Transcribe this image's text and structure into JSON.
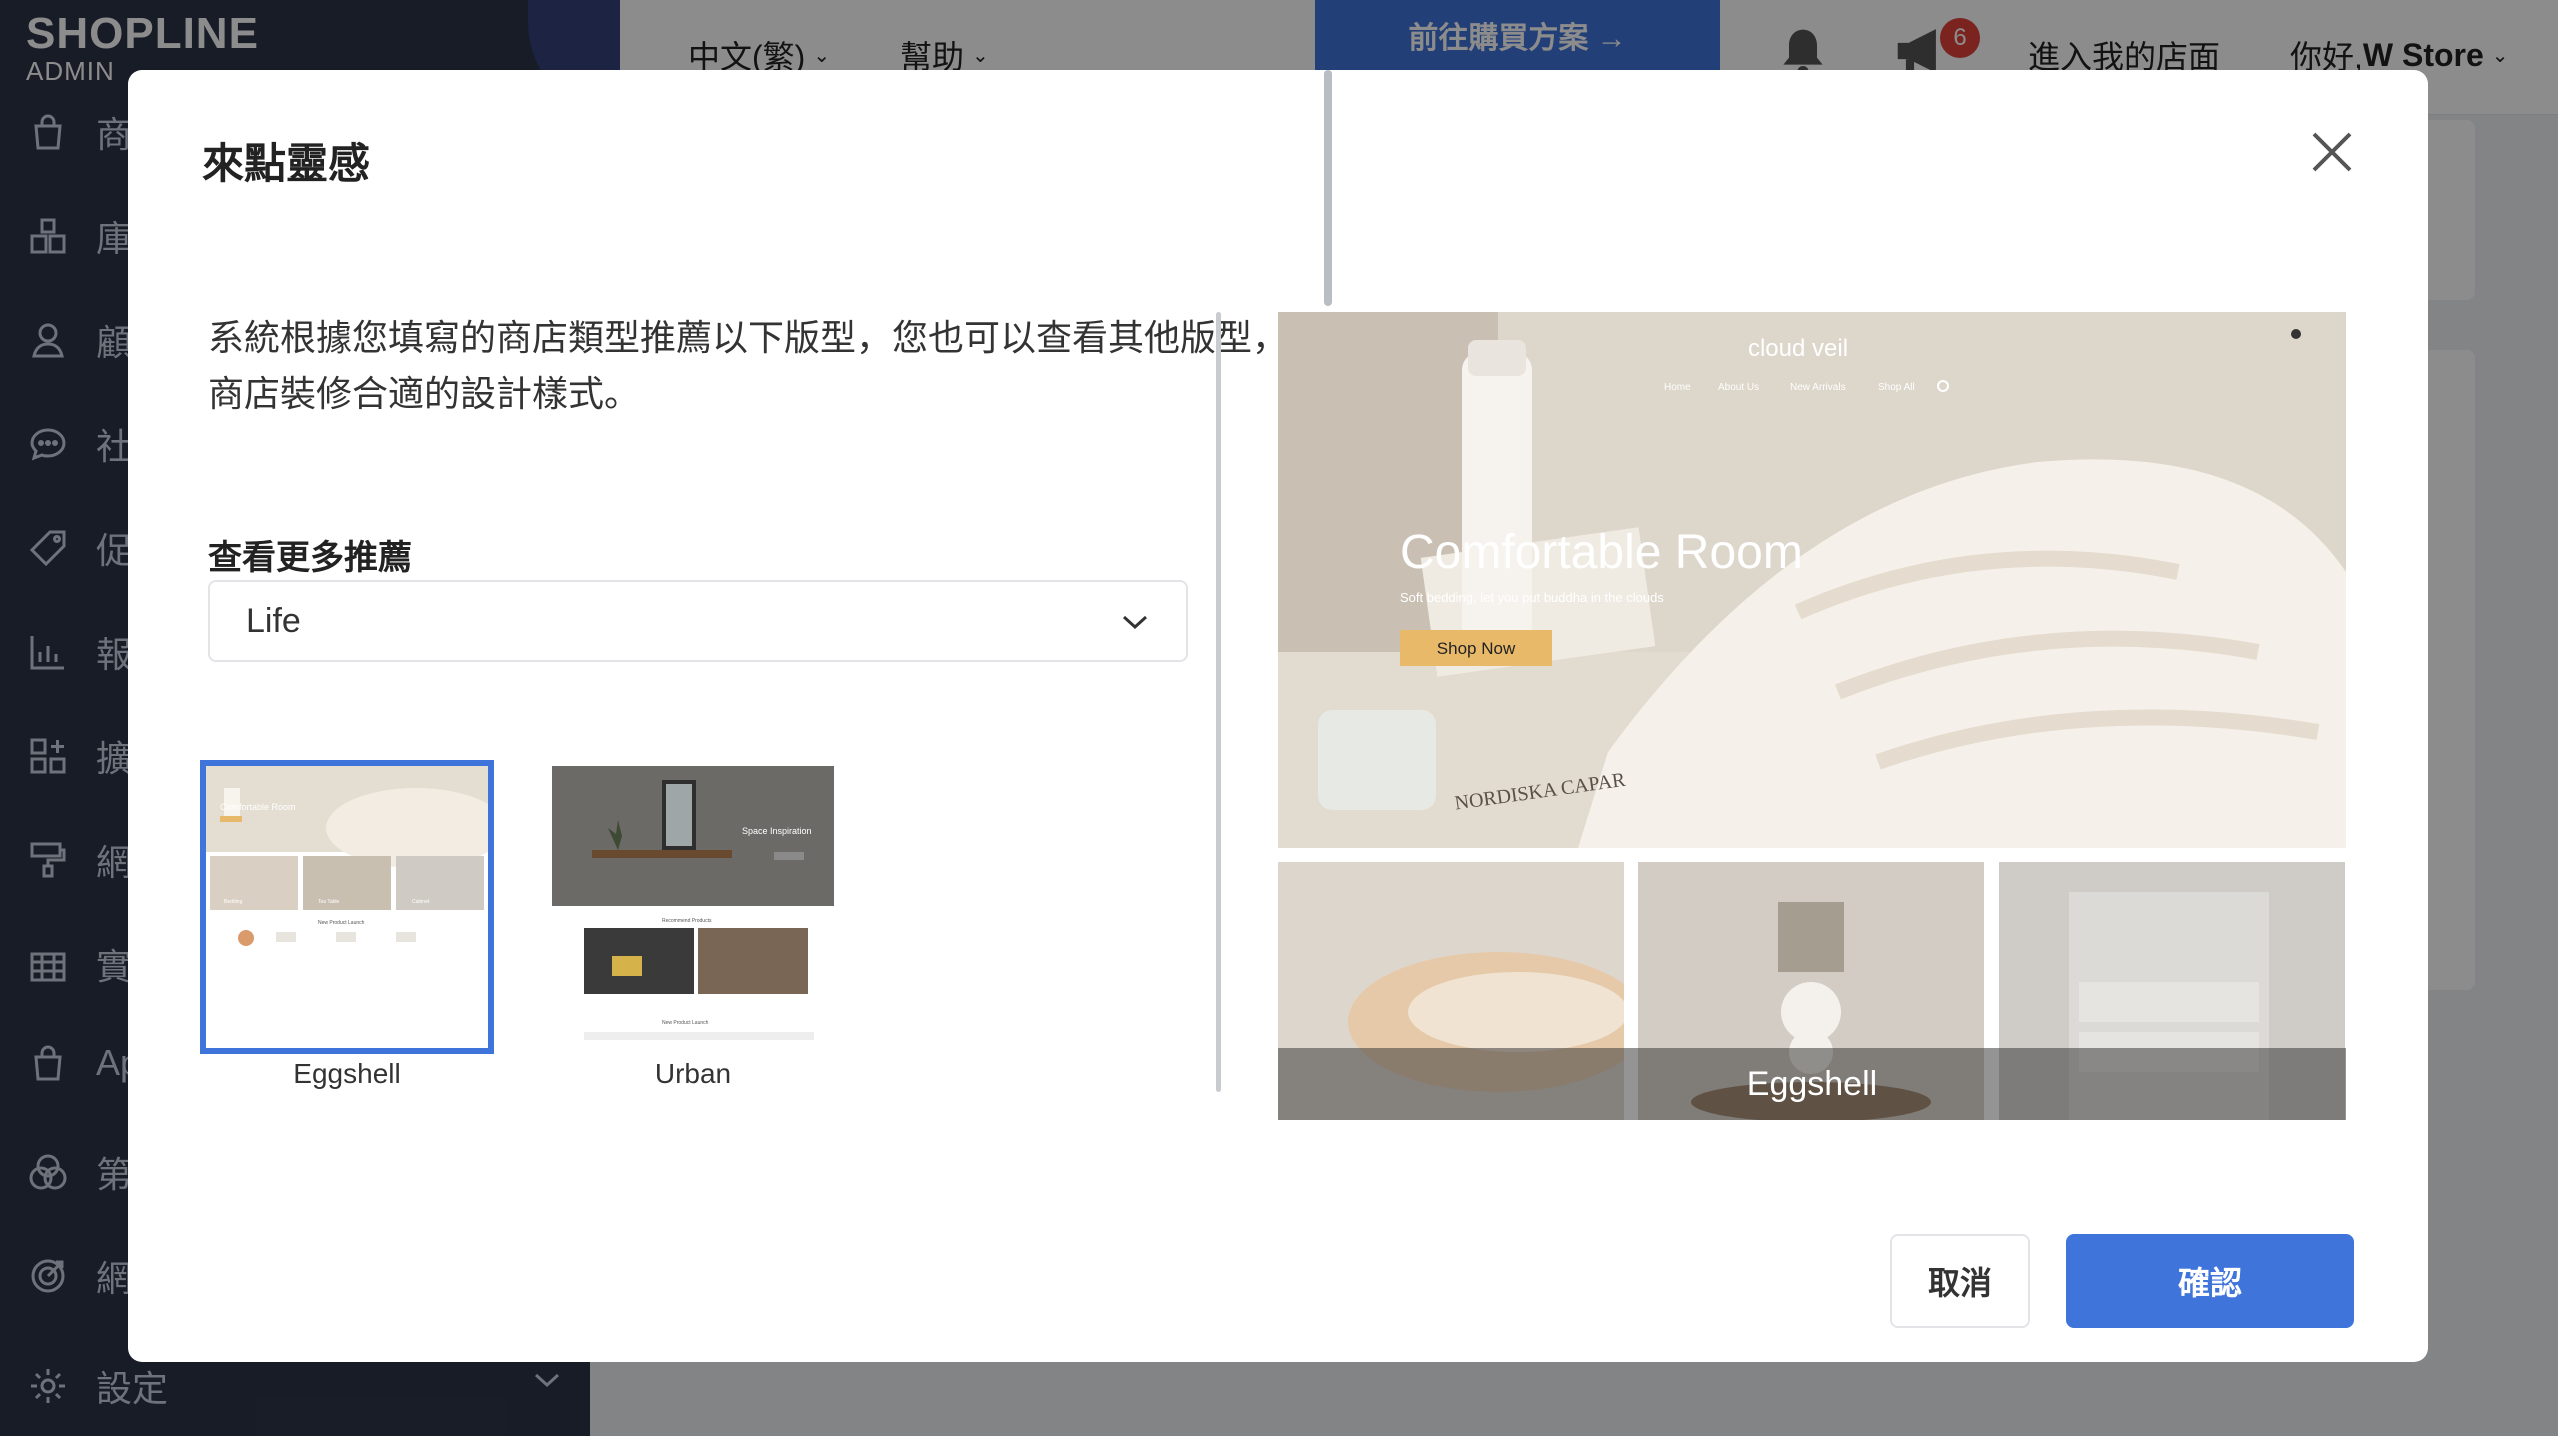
{
  "app": {
    "logo_brand": "SHOPLINE",
    "logo_sub": "ADMIN"
  },
  "sidebar": {
    "items": [
      {
        "label": "商",
        "icon": "bag-icon"
      },
      {
        "label": "庫",
        "icon": "inventory-icon"
      },
      {
        "label": "顧",
        "icon": "user-icon"
      },
      {
        "label": "社",
        "icon": "chat-icon"
      },
      {
        "label": "促",
        "icon": "tag-icon"
      },
      {
        "label": "報",
        "icon": "report-icon"
      },
      {
        "label": "擴",
        "icon": "apps-icon"
      },
      {
        "label": "網",
        "icon": "brush-icon"
      },
      {
        "label": "實",
        "icon": "store-icon"
      },
      {
        "label": "Ap",
        "icon": "app-bag-icon"
      },
      {
        "label": "第",
        "icon": "circles-icon"
      },
      {
        "label": "網",
        "icon": "target-icon"
      },
      {
        "label": "設定",
        "icon": "gear-icon"
      }
    ]
  },
  "topbar": {
    "language": "中文(繁)",
    "help": "幫助",
    "buy_plan": "前往購買方案 →",
    "notification_count": "6",
    "store_link": "進入我的店面",
    "greeting": "你好, ",
    "store_name": "W Store"
  },
  "modal": {
    "title": "來點靈感",
    "description": "系統根據您填寫的商店類型推薦以下版型，您也可以查看其他版型，為商店裝修合適的設計樣式。",
    "more_label": "查看更多推薦",
    "select_value": "Life",
    "themes": [
      {
        "name": "Eggshell",
        "selected": true
      },
      {
        "name": "Urban",
        "selected": false
      }
    ],
    "preview": {
      "site_name": "cloud veil",
      "nav": [
        "Home",
        "About Us",
        "New Arrivals",
        "Shop All"
      ],
      "hero_title": "Comfortable Room",
      "hero_sub": "Soft bedding, let you put buddha in the clouds",
      "hero_button": "Shop Now",
      "book_text": "NORDISKA CAPAR",
      "caption": "Eggshell"
    },
    "thumb_eggshell": {
      "hero": "Comfortable Room",
      "labels": [
        "Bedding",
        "Tea Table",
        "Cabinet"
      ],
      "section": "New Product Launch"
    },
    "thumb_urban": {
      "hero": "Space Inspiration",
      "section_top": "Recommend Products",
      "section_bottom": "New Product Launch"
    },
    "cancel": "取消",
    "confirm": "確認"
  },
  "colors": {
    "sidebar_bg": "#2c3448",
    "accent": "#3f74da",
    "badge": "#e0413a"
  }
}
